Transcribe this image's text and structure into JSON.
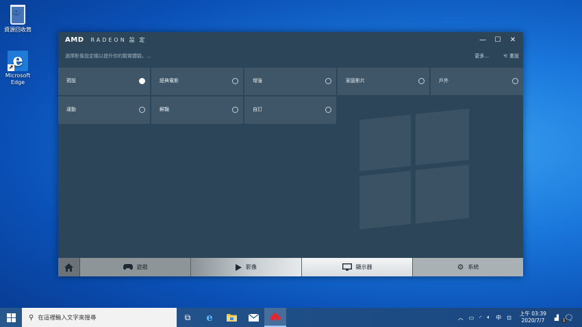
{
  "desktop": {
    "recycle_bin_label": "資源回收筒",
    "edge_label": "Microsoft Edge"
  },
  "window": {
    "brand": "AMD",
    "product": "RADEON",
    "title_suffix": "設 定",
    "controls": {
      "minimize": "—",
      "maximize": "☐",
      "close": "✕"
    },
    "hint": "選擇影像設定檔以提升你的觀賞體驗。...",
    "more_label": "更多...",
    "reset_label": "重設",
    "presets": [
      {
        "label": "預設",
        "selected": true
      },
      {
        "label": "經典電影",
        "selected": false
      },
      {
        "label": "增強",
        "selected": false
      },
      {
        "label": "家庭影片",
        "selected": false
      },
      {
        "label": "戶外",
        "selected": false
      },
      {
        "label": "運動",
        "selected": false
      },
      {
        "label": "鮮豔",
        "selected": false
      },
      {
        "label": "自訂",
        "selected": false
      }
    ],
    "nav": {
      "home_icon": "home-icon",
      "games": "遊戲",
      "video": "影像",
      "display": "顯示器",
      "system": "系統"
    }
  },
  "taskbar": {
    "search_placeholder": "在這裡輸入文字來搜尋",
    "ime": "中",
    "time": "上午 03:39",
    "date": "2020/7/7",
    "notification_count": "1"
  }
}
